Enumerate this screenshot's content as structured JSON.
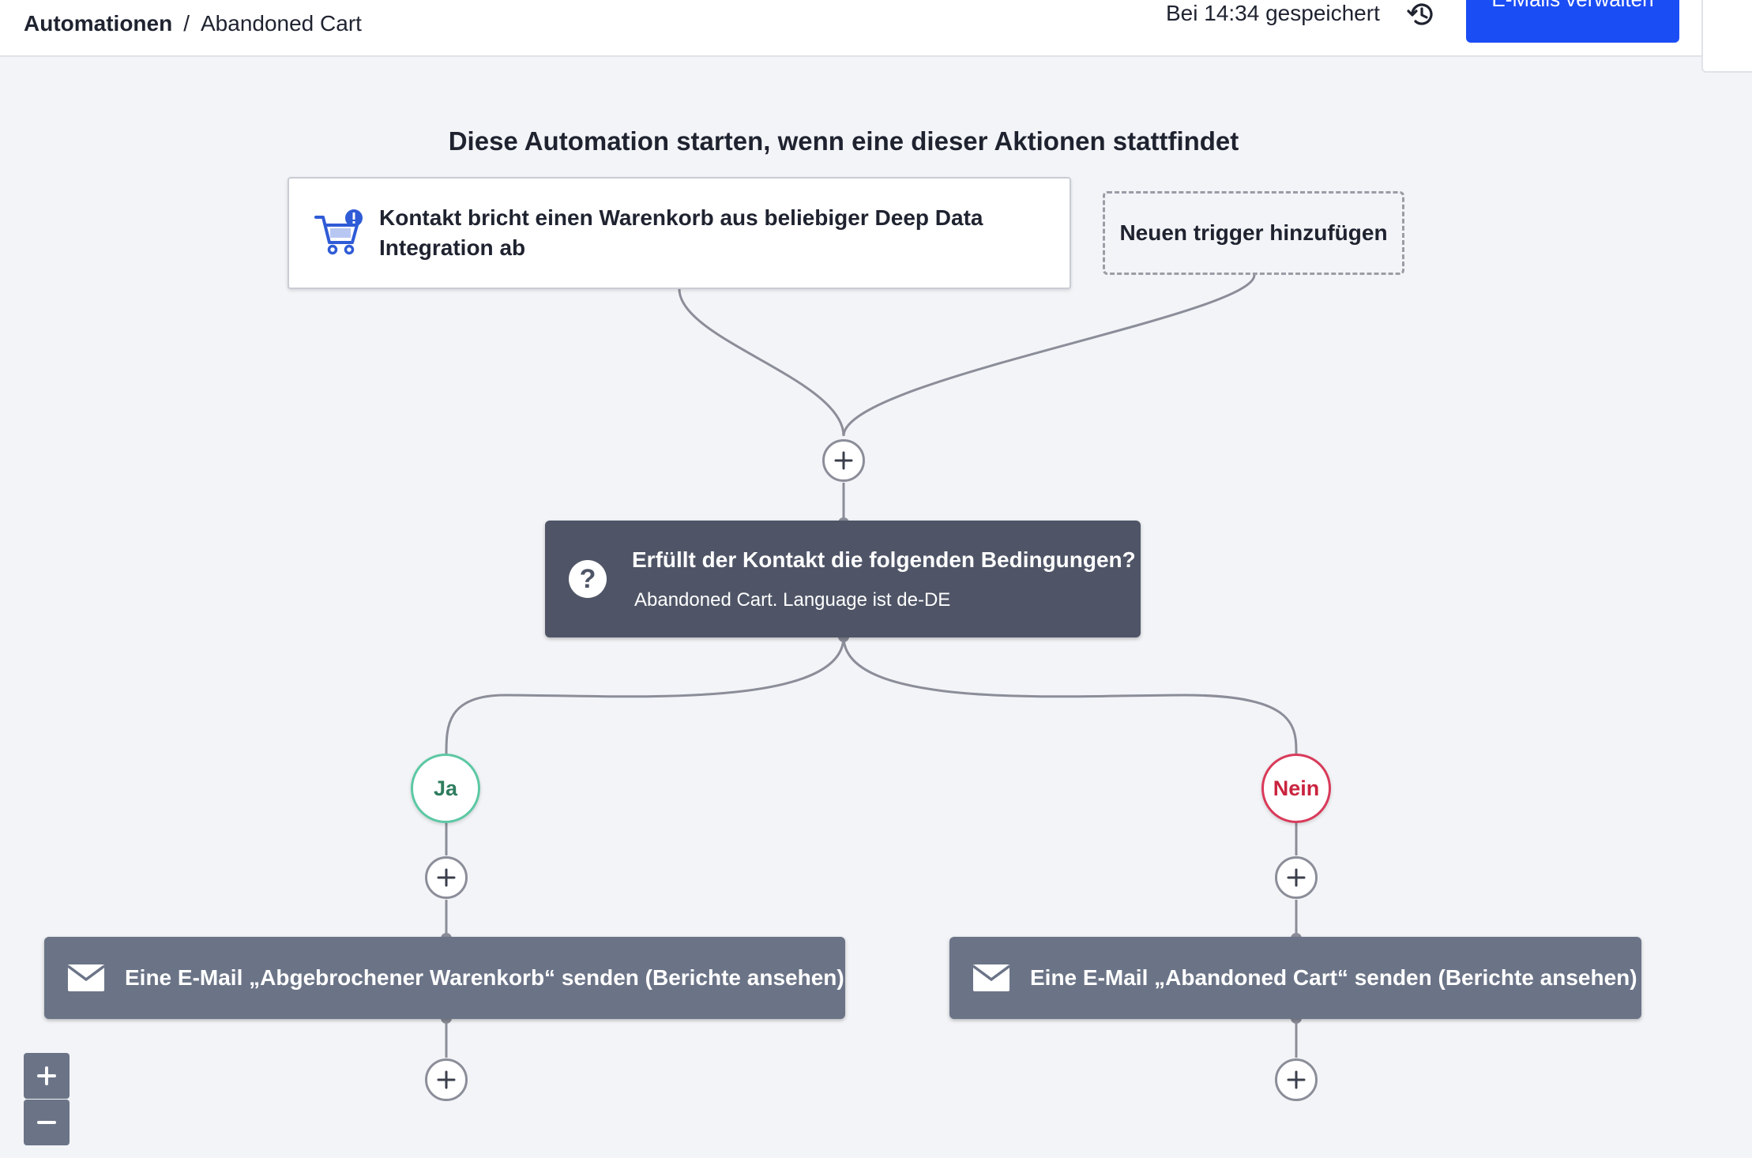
{
  "header": {
    "breadcrumb_root": "Automationen",
    "breadcrumb_separator": "/",
    "breadcrumb_current": "Abandoned Cart",
    "saved_status": "Bei 14:34 gespeichert",
    "history_icon": "history-icon",
    "manage_emails_label": "E-Mails verwalten"
  },
  "canvas": {
    "heading": "Diese Automation starten, wenn eine dieser Aktionen stattfindet",
    "trigger": {
      "icon": "cart-alert-icon",
      "label": "Kontakt bricht einen Warenkorb aus beliebiger Deep Data Integration ab"
    },
    "add_trigger_label": "Neuen trigger hinzufügen",
    "condition": {
      "icon": "question-icon",
      "title": "Erfüllt der Kontakt die folgenden Bedingungen?",
      "subtitle": "Abandoned Cart. Language ist de-DE"
    },
    "branches": {
      "yes_label": "Ja",
      "no_label": "Nein"
    },
    "actions": {
      "yes_email": "Eine E-Mail „Abgebrochener Warenkorb“ senden (Berichte ansehen)",
      "no_email": "Eine E-Mail „Abandoned Cart“ senden (Berichte ansehen)",
      "icon": "envelope-icon"
    }
  },
  "colors": {
    "primary": "#1b4df5",
    "condition_bg": "#4f5567",
    "action_bg": "#6b7487",
    "yes_branch": "#5cc8a3",
    "no_branch": "#d93a5a",
    "canvas_bg": "#f3f4f7"
  }
}
